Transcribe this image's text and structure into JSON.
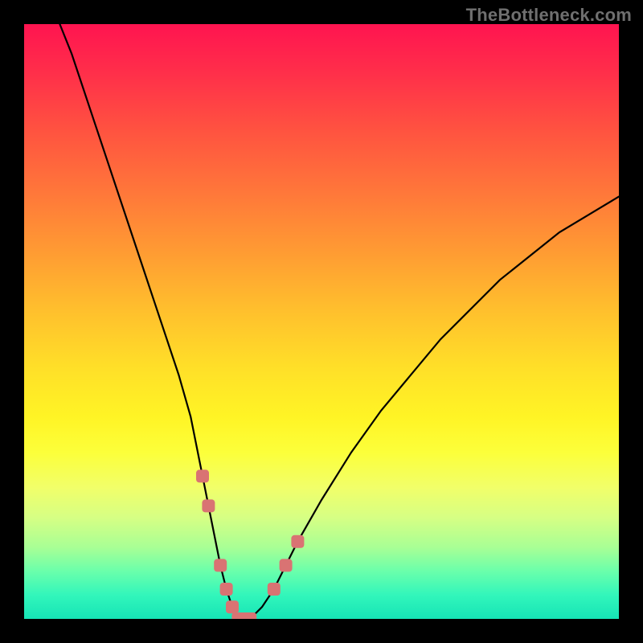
{
  "watermark": "TheBottleneck.com",
  "chart_data": {
    "type": "line",
    "title": "",
    "xlabel": "",
    "ylabel": "",
    "xlim": [
      0,
      100
    ],
    "ylim": [
      0,
      100
    ],
    "grid": false,
    "legend": false,
    "series": [
      {
        "name": "bottleneck-curve",
        "color": "#000000",
        "x": [
          6,
          8,
          10,
          12,
          14,
          16,
          18,
          20,
          22,
          24,
          26,
          28,
          30,
          31,
          32,
          33,
          34,
          35,
          36,
          37,
          38,
          40,
          42,
          44,
          46,
          50,
          55,
          60,
          65,
          70,
          75,
          80,
          85,
          90,
          95,
          100
        ],
        "y": [
          100,
          95,
          89,
          83,
          77,
          71,
          65,
          59,
          53,
          47,
          41,
          34,
          24,
          19,
          14,
          9,
          5,
          2,
          0,
          0,
          0,
          2,
          5,
          9,
          13,
          20,
          28,
          35,
          41,
          47,
          52,
          57,
          61,
          65,
          68,
          71
        ]
      },
      {
        "name": "bottleneck-markers",
        "color": "#d97373",
        "x": [
          30,
          31,
          33,
          34,
          35,
          36,
          37,
          38,
          42,
          44,
          46
        ],
        "y": [
          24,
          19,
          9,
          5,
          2,
          0,
          0,
          0,
          5,
          9,
          13
        ]
      }
    ],
    "gradient_stops": [
      {
        "pos": 0.0,
        "color": "#ff1450"
      },
      {
        "pos": 0.18,
        "color": "#ff5340"
      },
      {
        "pos": 0.38,
        "color": "#ff9a33"
      },
      {
        "pos": 0.58,
        "color": "#ffe028"
      },
      {
        "pos": 0.72,
        "color": "#fcff3a"
      },
      {
        "pos": 0.88,
        "color": "#a8ff95"
      },
      {
        "pos": 1.0,
        "color": "#16e4b6"
      }
    ]
  }
}
